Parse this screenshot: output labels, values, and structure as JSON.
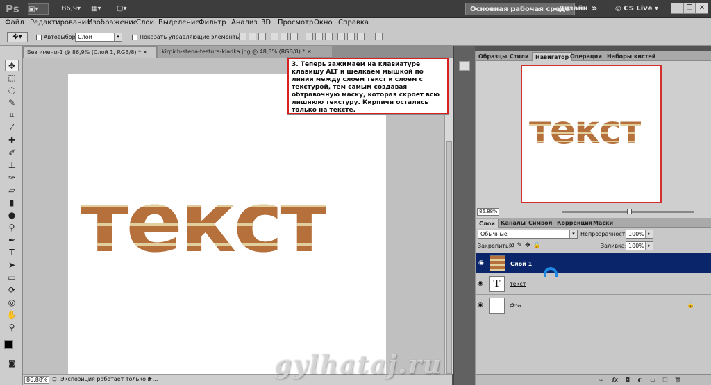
{
  "titlebar": {
    "logo": "Ps",
    "zoom": "86,9",
    "workspace_active": "Основная рабочая среда",
    "workspace_design": "Дизайн",
    "more": "»",
    "cs_live": "CS Live"
  },
  "menu": [
    "Файл",
    "Редактирование",
    "Изображение",
    "Слои",
    "Выделение",
    "Фильтр",
    "Анализ",
    "3D",
    "Просмотр",
    "Окно",
    "Справка"
  ],
  "options": {
    "autoselect_label": "Автовыбор:",
    "autoselect_value": "Слой",
    "show_controls": "Показать управляющие элементы"
  },
  "tabs": [
    {
      "label": "Без имени-1 @ 86,9% (Слой 1, RGB/8) *"
    },
    {
      "label": "kirpich-stena-testura-kladka.jpg @ 48,8% (RGB/8) *"
    }
  ],
  "canvas": {
    "text": "текст"
  },
  "callout": {
    "text": "3. Теперь зажимаем на клавиатуре клавишу ALT и щелкаем мышкой по линии между слоем текст и слоем с текстурой, тем самым создавая обтравочную маску, которая скроет всю лишнюю текстуру. Кирпичи остались только на тексте."
  },
  "status": {
    "zoom": "86.88%",
    "info": "Экспозиция работает только в ..."
  },
  "watermark": "gylhataj.ru",
  "nav_panel": {
    "tabs": [
      "Образцы",
      "Стили",
      "Навигатор",
      "Операции",
      "Наборы кистей"
    ],
    "active_tab": "Навигатор",
    "preview_text": "текст",
    "zoom": "86.88%"
  },
  "layers_panel": {
    "tabs": [
      "Слои",
      "Каналы",
      "Символ",
      "Коррекция",
      "Маски"
    ],
    "blend_mode": "Обычные",
    "opacity_label": "Непрозрачность:",
    "opacity_value": "100%",
    "lock_label": "Закрепить:",
    "fill_label": "Заливка:",
    "fill_value": "100%",
    "layers": [
      {
        "name": "Слой 1",
        "selected": true
      },
      {
        "name": "текст",
        "type_icon": "T"
      },
      {
        "name": "Фон",
        "locked": true
      }
    ]
  },
  "colors": {
    "accent_red": "#d62121",
    "selected_layer": "#0a256a",
    "cursor_blue": "#1e88e5"
  }
}
